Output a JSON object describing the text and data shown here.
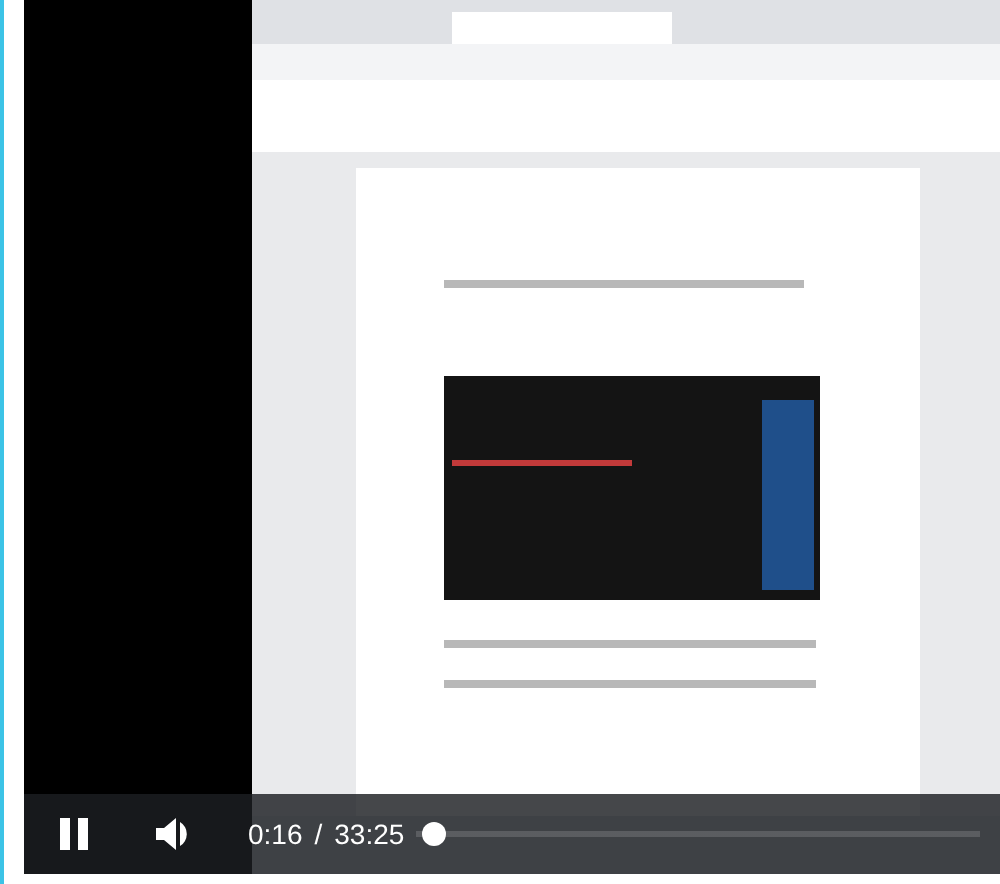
{
  "controls": {
    "playing": true,
    "muted": false,
    "current_time": "0:16",
    "separator": "/",
    "duration": "33:25",
    "progress": {
      "level": 0.01
    }
  }
}
